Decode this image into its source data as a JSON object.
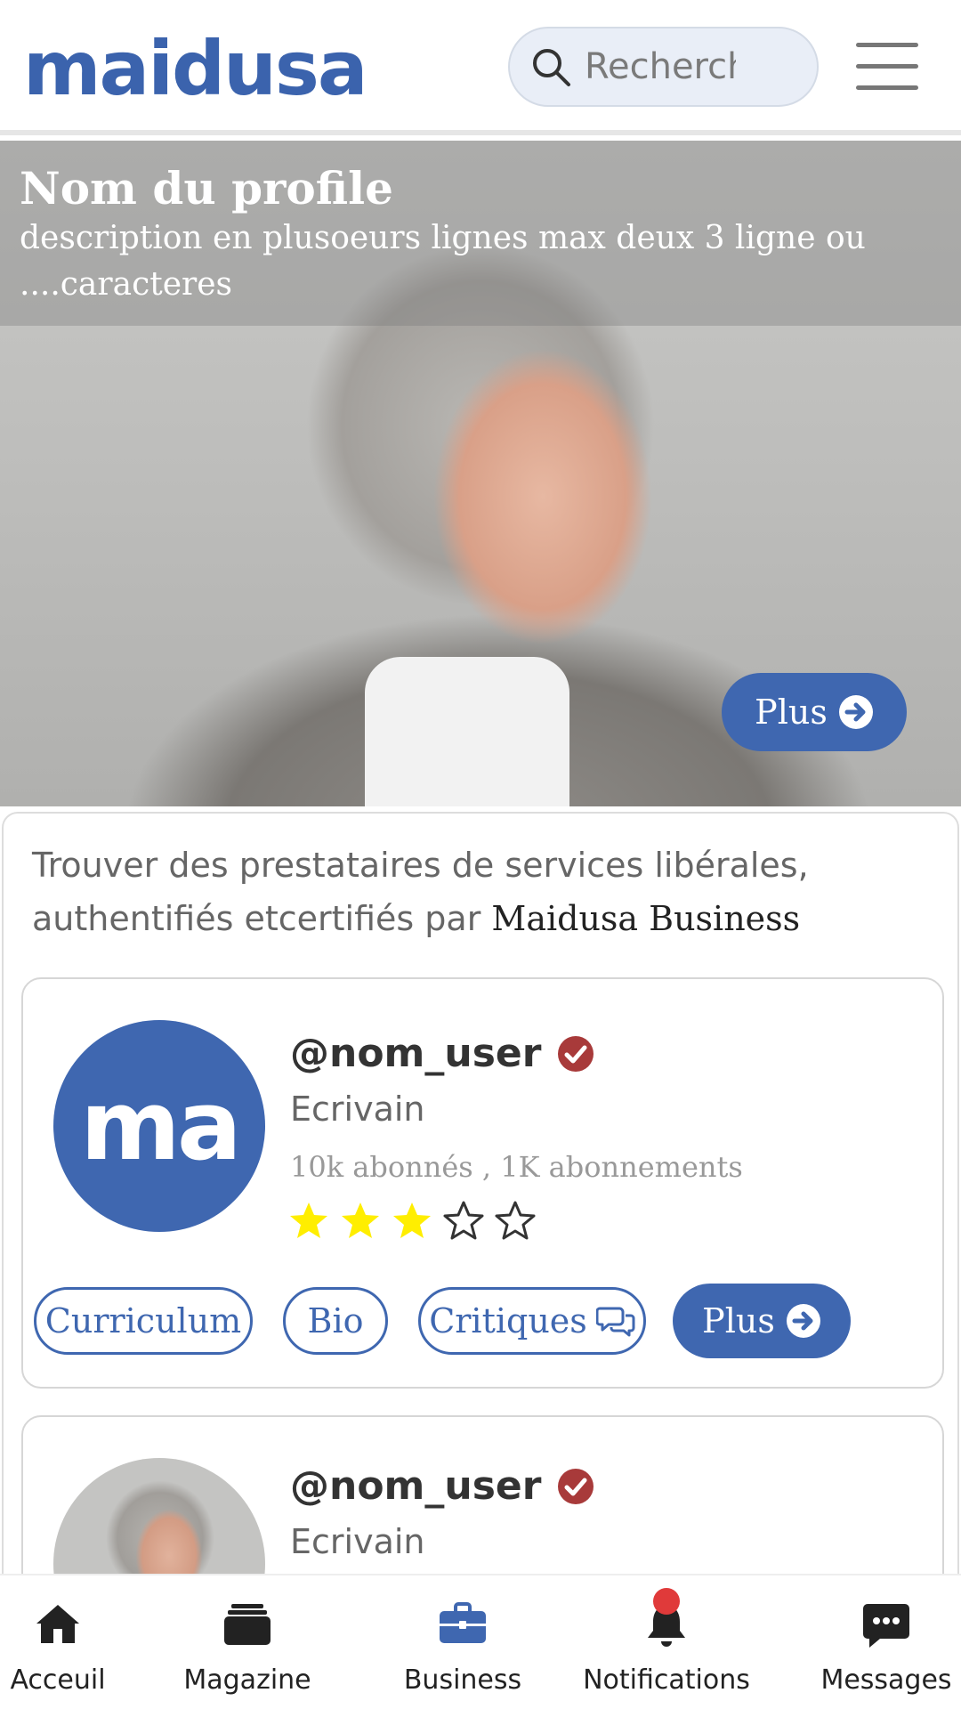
{
  "header": {
    "logo": "maidusa",
    "search_placeholder": "Recherche"
  },
  "hero": {
    "title": "Nom du profile",
    "description": "description en plusoeurs lignes max deux 3 ligne ou ....caracteres",
    "plus_label": "Plus"
  },
  "intro": {
    "text": "Trouver des prestataires de services libérales, authentifiés etcertifiés par ",
    "brand": "Maidusa Business"
  },
  "cards": [
    {
      "avatar_text": "ma",
      "username": "@nom_user",
      "role": "Ecrivain",
      "stats": "10k abonnés , 1K abonnements",
      "rating": 3,
      "rating_max": 5,
      "buttons": {
        "curriculum": "Curriculum",
        "bio": "Bio",
        "critiques": "Critiques",
        "plus": "Plus"
      }
    },
    {
      "username": "@nom_user",
      "role": "Ecrivain"
    }
  ],
  "nav": [
    {
      "label": "Acceuil",
      "icon": "home-icon"
    },
    {
      "label": "Magazine",
      "icon": "magazine-icon"
    },
    {
      "label": "Business",
      "icon": "briefcase-icon"
    },
    {
      "label": "Notifications",
      "icon": "bell-icon"
    },
    {
      "label": "Messages",
      "icon": "chat-icon"
    }
  ],
  "colors": {
    "brand_blue": "#3f67b0",
    "star_yellow": "#ffee00",
    "verified_red": "#a83a3a",
    "notification_red": "#e03a3a"
  }
}
